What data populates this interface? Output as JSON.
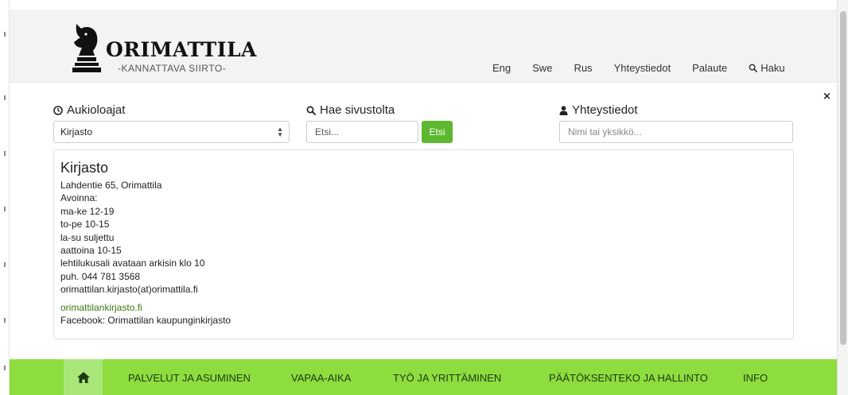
{
  "brand": {
    "name": "ORIMATTILA",
    "tagline": "-KANNATTAVA SIIRTO-"
  },
  "topnav": {
    "items": [
      "Eng",
      "Swe",
      "Rus",
      "Yhteystiedot",
      "Palaute"
    ],
    "search_label": "Haku"
  },
  "panel": {
    "close_label": "×",
    "opening_hours": {
      "title": "Aukioloajat",
      "selected": "Kirjasto"
    },
    "site_search": {
      "title": "Hae sivustolta",
      "placeholder": "Etsi...",
      "button": "Etsi"
    },
    "contacts": {
      "title": "Yhteystiedot",
      "placeholder": "Nimi tai yksikkö..."
    },
    "info": {
      "name": "Kirjasto",
      "lines": [
        "Lahdentie 65, Orimattila",
        "Avoinna:",
        "ma-ke 12-19",
        "to-pe 10-15",
        "la-su suljettu",
        "aattoina 10-15",
        "lehtilukusali avataan arkisin klo 10",
        "puh. 044 781 3568",
        "orimattilan.kirjasto(at)orimattila.fi"
      ],
      "link": "orimattilankirjasto.fi",
      "facebook": "Facebook: Orimattilan kaupunginkirjasto"
    }
  },
  "mainnav": {
    "items": [
      "PALVELUT JA ASUMINEN",
      "VAPAA-AIKA",
      "TYÖ JA YRITTÄMINEN",
      "PÄÄTÖKSENTEKO JA HALLINTO",
      "INFO"
    ]
  },
  "colors": {
    "green_bar": "#8ddd3f",
    "green_button": "#5cb82e",
    "link_green": "#3b7a12",
    "header_bg": "#f3f3f3"
  }
}
